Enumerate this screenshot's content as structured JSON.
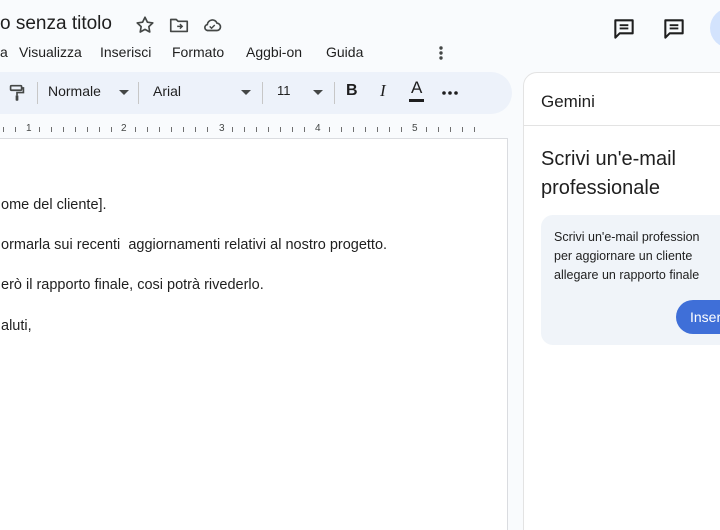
{
  "document": {
    "title": "o senza titolo"
  },
  "menu": {
    "items": [
      "a",
      "Visualizza",
      "Inserisci",
      "Formato",
      "Aggbi-on",
      "Guida"
    ]
  },
  "toolbar": {
    "style": "Normale",
    "font": "Arial",
    "size": "11",
    "bold": "B",
    "italic": "I",
    "text_color": "A"
  },
  "ruler": {
    "numbers": [
      "1",
      "2",
      "3",
      "4",
      "5"
    ]
  },
  "body": {
    "lines": [
      "ome del cliente].",
      "ormarla sui recenti  aggiornamenti relativi al nostro progetto.",
      "erò il rapporto finale, cosi potrà rivederlo.",
      "aluti,"
    ]
  },
  "gemini": {
    "title": "Gemini",
    "heading_lines": [
      "Scrivi un'e-mail",
      "professionale"
    ],
    "prompt_lines": [
      "Scrivi un'e-mail profession",
      "per aggiornare un cliente",
      "allegare un rapporto finale"
    ],
    "insert_label": "Inser"
  },
  "colors": {
    "accent": "#3f6fd8",
    "toolbar_bg": "#edf2fa",
    "card_bg": "#f0f4f9"
  }
}
